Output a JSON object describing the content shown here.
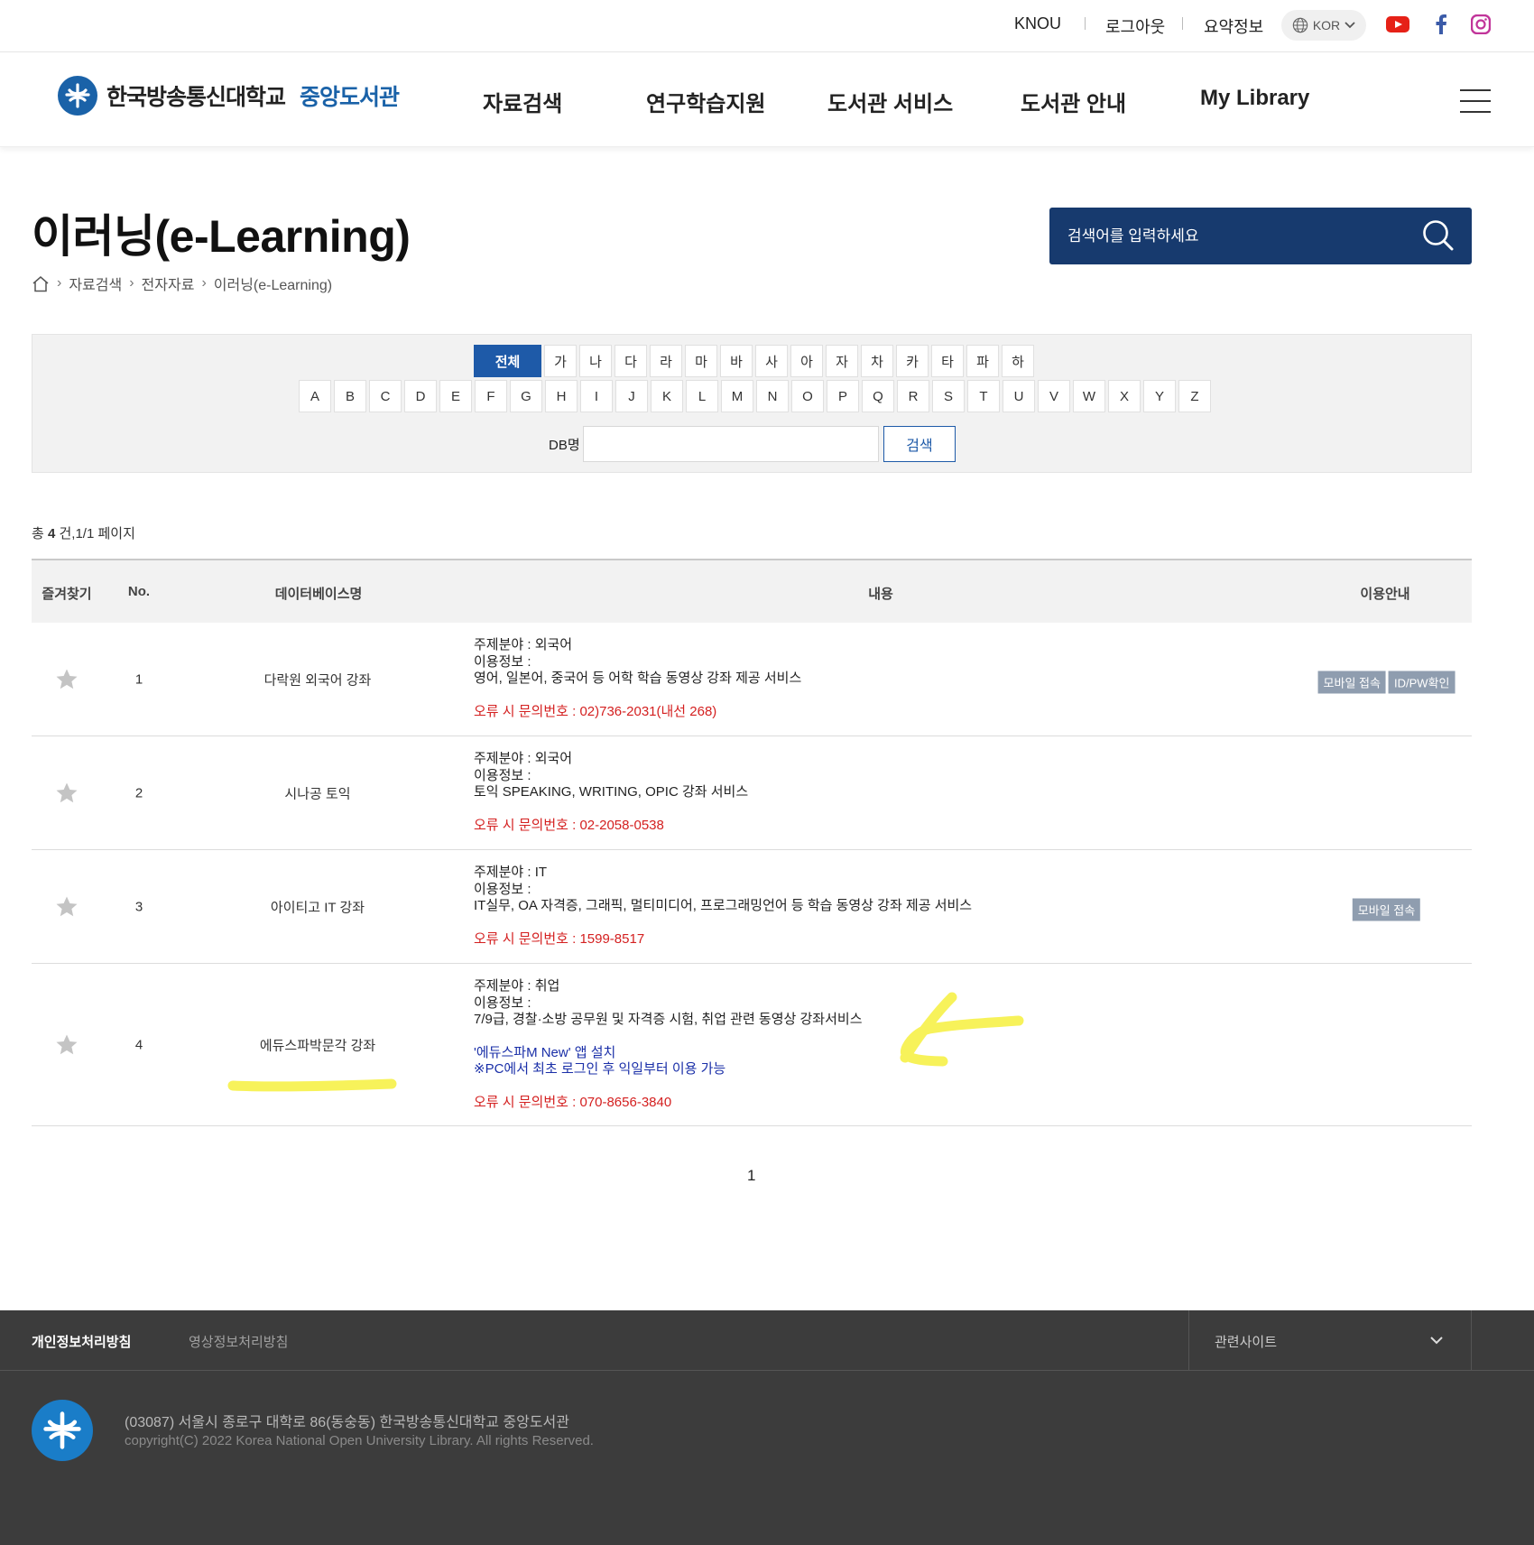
{
  "topbar": {
    "knou": "KNOU",
    "logout": "로그아웃",
    "summary": "요약정보",
    "lang": "KOR"
  },
  "header": {
    "logo_main": "한국방송통신대학교",
    "logo_sub": "중앙도서관",
    "nav": [
      "자료검색",
      "연구학습지원",
      "도서관 서비스",
      "도서관 안내",
      "My Library"
    ]
  },
  "page": {
    "title": "이러닝(e-Learning)",
    "breadcrumb": [
      "자료검색",
      "전자자료",
      "이러닝(e-Learning)"
    ],
    "search_placeholder": "검색어를 입력하세요"
  },
  "index": {
    "all_label": "전체",
    "korean": [
      "가",
      "나",
      "다",
      "라",
      "마",
      "바",
      "사",
      "아",
      "자",
      "차",
      "카",
      "타",
      "파",
      "하"
    ],
    "alpha": [
      "A",
      "B",
      "C",
      "D",
      "E",
      "F",
      "G",
      "H",
      "I",
      "J",
      "K",
      "L",
      "M",
      "N",
      "O",
      "P",
      "Q",
      "R",
      "S",
      "T",
      "U",
      "V",
      "W",
      "X",
      "Y",
      "Z"
    ],
    "db_label": "DB명",
    "db_value": "",
    "search_button": "검색"
  },
  "summary": {
    "prefix": "총",
    "count": "4",
    "suffix": "건,",
    "pages": "1/1",
    "page_word": "페이지"
  },
  "table": {
    "headers": {
      "favorite": "즐겨찾기",
      "no": "No.",
      "dbname": "데이터베이스명",
      "content": "내용",
      "usage": "이용안내"
    },
    "rows": [
      {
        "no": "1",
        "name": "다락원 외국어 강좌",
        "subject": "주제분야 : 외국어",
        "usage_info": "이용정보 :",
        "desc": "영어, 일본어, 중국어 등 어학 학습 동영상 강좌 제공 서비스",
        "extra1": "",
        "extra2": "",
        "error": "오류 시 문의번호 : 02)736-2031(내선 268)",
        "badges": [
          "모바일 접속",
          "ID/PW확인"
        ]
      },
      {
        "no": "2",
        "name": "시나공 토익",
        "subject": "주제분야 : 외국어",
        "usage_info": "이용정보 :",
        "desc": "토익 SPEAKING, WRITING, OPIC 강좌 서비스",
        "extra1": "",
        "extra2": "",
        "error": "오류 시 문의번호 : 02-2058-0538",
        "badges": []
      },
      {
        "no": "3",
        "name": "아이티고 IT 강좌",
        "subject": "주제분야 : IT",
        "usage_info": "이용정보 :",
        "desc": "IT실무, OA 자격증, 그래픽, 멀티미디어, 프로그래밍언어 등 학습 동영상 강좌 제공 서비스",
        "extra1": "",
        "extra2": "",
        "error": "오류 시 문의번호 : 1599-8517",
        "badges": [
          "모바일 접속"
        ]
      },
      {
        "no": "4",
        "name": "에듀스파박문각 강좌",
        "subject": "주제분야 : 취업",
        "usage_info": "이용정보 :",
        "desc": "7/9급, 경찰·소방 공무원 및 자격증 시험, 취업 관련 동영상 강좌서비스",
        "extra1": "'에듀스파M New' 앱 설치",
        "extra2": "※PC에서 최초 로그인 후 익일부터 이용 가능",
        "error": "오류 시 문의번호 : 070-8656-3840",
        "badges": []
      }
    ]
  },
  "pagination": {
    "current": "1"
  },
  "footer": {
    "privacy": "개인정보처리방침",
    "video_privacy": "영상정보처리방침",
    "related": "관련사이트",
    "address": "(03087) 서울시 종로구 대학로 86(동숭동) 한국방송통신대학교 중앙도서관",
    "copyright": "copyright(C) 2022 Korea National Open University Library. All rights Reserved."
  },
  "colors": {
    "navy": "#173a6e",
    "accent_blue": "#1e5aa8",
    "error_red": "#d42020",
    "footer_bg": "#3c3c3c",
    "annotation_yellow": "#f7f25a"
  }
}
